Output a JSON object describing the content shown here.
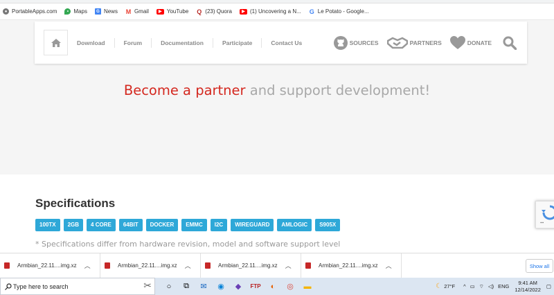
{
  "bookmarks": [
    {
      "label": "PortableApps.com",
      "icon": "portableapps-icon",
      "color": "#555555"
    },
    {
      "label": "Maps",
      "icon": "maps-pin-icon",
      "color": "#34a853"
    },
    {
      "label": "News",
      "icon": "news-icon",
      "color": "#4285f4"
    },
    {
      "label": "Gmail",
      "icon": "gmail-icon",
      "color": "#ea4335"
    },
    {
      "label": "YouTube",
      "icon": "youtube-icon",
      "color": "#ff0000"
    },
    {
      "label": "(23) Quora",
      "icon": "quora-icon",
      "color": "#b92b27"
    },
    {
      "label": "(1) Uncovering a N...",
      "icon": "youtube-icon",
      "color": "#ff0000"
    },
    {
      "label": "Le Potato - Google...",
      "icon": "google-icon",
      "color": "#4285f4"
    }
  ],
  "nav": {
    "links": [
      "Download",
      "Forum",
      "Documentation",
      "Participate",
      "Contact Us"
    ],
    "sources": "SOURCES",
    "partners": "PARTNERS",
    "donate": "DONATE"
  },
  "hero": {
    "accent": "Become a partner",
    "rest": " and support development!"
  },
  "specs": {
    "title": "Specifications",
    "tags": [
      "100TX",
      "2GB",
      "4 CORE",
      "64BIT",
      "DOCKER",
      "EMMC",
      "I2C",
      "WIREGUARD",
      "AMLOGIC",
      "S905X"
    ],
    "note": "* Specifications differ from hardware revision, model and software support level"
  },
  "downloads": {
    "items": [
      "Armbian_22.11....img.xz",
      "Armbian_22.11....img.xz",
      "Armbian_22.11....img.xz",
      "Armbian_22.11....img.xz"
    ],
    "show_all": "Show all"
  },
  "taskbar": {
    "search_placeholder": "Type here to search",
    "weather": "27°F",
    "lang": "ENG",
    "time": "9:41 AM",
    "date": "12/14/2022"
  },
  "colors": {
    "accent_red": "#d4281f",
    "tag_blue": "#2ea8d8"
  }
}
